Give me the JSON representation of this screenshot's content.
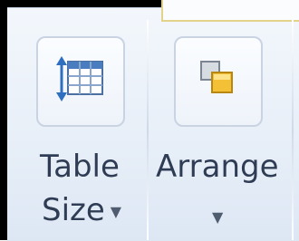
{
  "ribbon": {
    "buttons": [
      {
        "label_line1": "Table",
        "label_line2": "Size",
        "icon": "table-size-icon",
        "dropdown_glyph": "▼"
      },
      {
        "label_line1": "Arrange",
        "icon": "arrange-icon",
        "dropdown_glyph": "▼"
      }
    ]
  },
  "colors": {
    "ribbon_bg": "#e8eff8",
    "label_text": "#2e3d55",
    "icon_blue": "#2f6fbf",
    "icon_yellow": "#f4c035"
  }
}
